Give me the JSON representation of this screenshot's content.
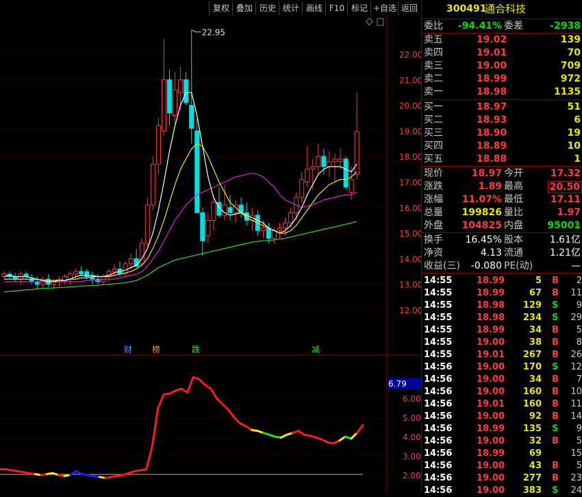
{
  "toolbar": {
    "buttons": [
      "复权",
      "叠加",
      "历史",
      "统计",
      "画线",
      "F10",
      "标记",
      "+自选",
      "返回"
    ]
  },
  "stock": {
    "code": "300491",
    "name": "通合科技"
  },
  "order_ratio": {
    "label1": "委比",
    "value1": "-94.41%",
    "label2": "委差",
    "value2": "-2938"
  },
  "sell_levels": [
    {
      "label": "卖五",
      "price": "19.02",
      "vol": "139"
    },
    {
      "label": "卖四",
      "price": "19.01",
      "vol": "70"
    },
    {
      "label": "卖三",
      "price": "19.00",
      "vol": "709"
    },
    {
      "label": "卖二",
      "price": "18.99",
      "vol": "972"
    },
    {
      "label": "卖一",
      "price": "18.98",
      "vol": "1135"
    }
  ],
  "buy_levels": [
    {
      "label": "买一",
      "price": "18.97",
      "vol": "51"
    },
    {
      "label": "买二",
      "price": "18.93",
      "vol": "6"
    },
    {
      "label": "买三",
      "price": "18.90",
      "vol": "19"
    },
    {
      "label": "买四",
      "price": "18.89",
      "vol": "10"
    },
    {
      "label": "买五",
      "price": "18.88",
      "vol": "1"
    }
  ],
  "quote": [
    {
      "l1": "现价",
      "v1": "18.97",
      "l2": "今开",
      "v2": "17.32"
    },
    {
      "l1": "涨跌",
      "v1": "1.89",
      "l2": "最高",
      "v2": "20.50"
    },
    {
      "l1": "涨幅",
      "v1": "11.07%",
      "l2": "最低",
      "v2": "17.11"
    },
    {
      "l1": "总量",
      "v1": "199826",
      "l2": "量比",
      "v2": "1.97"
    },
    {
      "l1": "外盘",
      "v1": "104825",
      "l2": "内盘",
      "v2": "95001"
    }
  ],
  "fundamentals": [
    {
      "l1": "换手",
      "v1": "16.45%",
      "l2": "股本",
      "v2": "1.61亿"
    },
    {
      "l1": "净资",
      "v1": "4.13",
      "l2": "流通",
      "v2": "1.21亿"
    },
    {
      "l1": "收益(三)",
      "v1": "-0.080",
      "l2": "PE(动)",
      "v2": "—"
    }
  ],
  "ticks": [
    {
      "time": "14:55",
      "price": "18.99",
      "vol": "5",
      "side": "B",
      "n": "2"
    },
    {
      "time": "14:55",
      "price": "18.99",
      "vol": "67",
      "side": "B",
      "n": "11"
    },
    {
      "time": "14:55",
      "price": "18.98",
      "vol": "129",
      "side": "S",
      "n": "9"
    },
    {
      "time": "14:55",
      "price": "18.98",
      "vol": "234",
      "side": "S",
      "n": "29"
    },
    {
      "time": "14:55",
      "price": "18.99",
      "vol": "34",
      "side": "B",
      "n": "5"
    },
    {
      "time": "14:55",
      "price": "19.00",
      "vol": "38",
      "side": "B",
      "n": "8"
    },
    {
      "time": "14:55",
      "price": "19.01",
      "vol": "267",
      "side": "B",
      "n": "26"
    },
    {
      "time": "14:56",
      "price": "19.00",
      "vol": "170",
      "side": "S",
      "n": "12"
    },
    {
      "time": "14:56",
      "price": "19.00",
      "vol": "34",
      "side": "B",
      "n": "7"
    },
    {
      "time": "14:56",
      "price": "19.00",
      "vol": "160",
      "side": "B",
      "n": "10"
    },
    {
      "time": "14:56",
      "price": "19.01",
      "vol": "160",
      "side": "B",
      "n": "11"
    },
    {
      "time": "14:56",
      "price": "19.00",
      "vol": "92",
      "side": "B",
      "n": "14"
    },
    {
      "time": "14:56",
      "price": "18.99",
      "vol": "135",
      "side": "S",
      "n": "9"
    },
    {
      "time": "14:56",
      "price": "19.00",
      "vol": "32",
      "side": "B",
      "n": "5"
    },
    {
      "time": "14:56",
      "price": "18.99",
      "vol": "69",
      "side": "",
      "n": "15"
    },
    {
      "time": "14:56",
      "price": "19.00",
      "vol": "43",
      "side": "B",
      "n": "5"
    },
    {
      "time": "14:56",
      "price": "19.00",
      "vol": "277",
      "side": "B",
      "n": "23"
    },
    {
      "time": "14:56",
      "price": "19.00",
      "vol": "383",
      "side": "S",
      "n": "24"
    }
  ],
  "chart": {
    "price_axis": [
      "22.00",
      "21.00",
      "20.00",
      "19.00",
      "18.00",
      "17.00",
      "16.00",
      "15.00",
      "14.00",
      "13.00",
      "12.00"
    ],
    "peak_label": "22.95",
    "event_markers": [
      "财",
      "榜",
      "跌",
      "减"
    ],
    "indicator_axis": [
      "6.00",
      "5.00",
      "4.00",
      "3.00",
      "2.00"
    ],
    "indicator_current": "6.79"
  },
  "chart_data": {
    "type": "line",
    "title": "",
    "xlabel": "",
    "ylabel": "",
    "ylim": [
      11.5,
      23.0
    ],
    "candles_ohlc": [
      [
        13.3,
        13.5,
        13.2,
        13.4
      ],
      [
        13.4,
        13.5,
        13.2,
        13.3
      ],
      [
        13.3,
        13.45,
        13.1,
        13.2
      ],
      [
        13.2,
        13.5,
        13.0,
        13.4
      ],
      [
        13.4,
        13.5,
        13.2,
        13.3
      ],
      [
        13.2,
        13.4,
        13.0,
        13.1
      ],
      [
        13.1,
        13.3,
        12.8,
        13.0
      ],
      [
        13.0,
        13.3,
        12.8,
        13.2
      ],
      [
        13.2,
        13.4,
        12.9,
        13.0
      ],
      [
        13.0,
        13.2,
        12.8,
        13.1
      ],
      [
        13.1,
        13.3,
        12.9,
        13.2
      ],
      [
        13.1,
        13.4,
        13.0,
        13.3
      ],
      [
        13.2,
        13.5,
        13.0,
        13.4
      ],
      [
        13.4,
        13.6,
        13.2,
        13.5
      ],
      [
        13.5,
        13.7,
        13.3,
        13.4
      ],
      [
        13.5,
        13.6,
        13.2,
        13.3
      ],
      [
        13.3,
        13.5,
        13.0,
        13.2
      ],
      [
        13.2,
        13.4,
        13.0,
        13.1
      ],
      [
        13.1,
        13.4,
        13.0,
        13.3
      ],
      [
        13.3,
        13.6,
        13.1,
        13.5
      ],
      [
        13.5,
        13.8,
        13.3,
        13.6
      ],
      [
        13.6,
        13.9,
        13.3,
        13.4
      ],
      [
        13.4,
        13.9,
        13.3,
        13.8
      ],
      [
        13.8,
        14.2,
        13.6,
        14.0
      ],
      [
        14.0,
        14.4,
        13.8,
        13.7
      ],
      [
        13.8,
        14.8,
        13.7,
        14.6
      ],
      [
        14.6,
        16.4,
        14.5,
        16.1
      ],
      [
        16.1,
        18.0,
        15.9,
        17.7
      ],
      [
        17.7,
        19.5,
        17.3,
        19.2
      ],
      [
        19.0,
        22.6,
        18.8,
        21.0
      ],
      [
        21.0,
        21.4,
        19.2,
        19.7
      ],
      [
        19.6,
        21.3,
        19.3,
        20.6
      ],
      [
        20.5,
        21.5,
        19.8,
        21.0
      ],
      [
        21.0,
        21.3,
        20.0,
        20.1
      ],
      [
        20.0,
        22.95,
        18.5,
        19.1
      ],
      [
        19.0,
        19.5,
        15.8,
        15.8
      ],
      [
        15.8,
        16.0,
        14.1,
        14.7
      ],
      [
        14.9,
        15.8,
        14.6,
        15.5
      ],
      [
        15.5,
        16.5,
        15.1,
        16.2
      ],
      [
        16.2,
        16.8,
        15.6,
        15.7
      ],
      [
        15.7,
        16.9,
        15.5,
        16.1
      ],
      [
        16.0,
        16.5,
        15.5,
        15.8
      ],
      [
        15.8,
        16.3,
        15.4,
        16.1
      ],
      [
        16.1,
        16.4,
        15.6,
        15.8
      ],
      [
        15.8,
        16.2,
        15.3,
        15.5
      ],
      [
        15.5,
        16.0,
        15.1,
        15.7
      ],
      [
        15.7,
        15.9,
        14.9,
        15.1
      ],
      [
        15.1,
        15.5,
        14.8,
        15.2
      ],
      [
        15.2,
        15.4,
        14.6,
        14.8
      ],
      [
        14.8,
        15.2,
        14.6,
        15.1
      ],
      [
        15.1,
        15.4,
        14.8,
        15.2
      ],
      [
        15.2,
        15.6,
        14.9,
        15.4
      ],
      [
        15.4,
        16.0,
        15.2,
        15.8
      ],
      [
        15.8,
        16.6,
        15.5,
        16.4
      ],
      [
        16.4,
        17.4,
        16.2,
        17.1
      ],
      [
        17.0,
        18.4,
        16.8,
        17.5
      ],
      [
        17.5,
        17.9,
        16.7,
        17.6
      ],
      [
        17.6,
        18.5,
        17.3,
        18.0
      ],
      [
        18.0,
        18.3,
        17.3,
        17.6
      ],
      [
        17.6,
        18.2,
        17.2,
        17.8
      ],
      [
        17.8,
        18.1,
        17.0,
        17.9
      ],
      [
        17.8,
        18.3,
        17.5,
        17.9
      ],
      [
        17.9,
        18.0,
        16.7,
        16.8
      ],
      [
        16.6,
        17.6,
        16.3,
        17.1
      ],
      [
        17.3,
        20.5,
        17.1,
        18.97
      ]
    ],
    "ma_white": [
      13.3,
      13.35,
      13.3,
      13.3,
      13.3,
      13.25,
      13.2,
      13.15,
      13.1,
      13.1,
      13.15,
      13.15,
      13.2,
      13.3,
      13.35,
      13.35,
      13.35,
      13.3,
      13.3,
      13.35,
      13.45,
      13.5,
      13.55,
      13.65,
      13.75,
      14.0,
      14.4,
      15.0,
      15.9,
      17.0,
      18.2,
      19.2,
      20.0,
      20.5,
      20.5,
      19.6,
      18.4,
      17.2,
      16.4,
      16.0,
      15.8,
      15.7,
      15.75,
      15.8,
      15.7,
      15.6,
      15.5,
      15.4,
      15.2,
      15.1,
      15.0,
      15.1,
      15.3,
      15.6,
      16.0,
      16.5,
      16.9,
      17.3,
      17.5,
      17.6,
      17.6,
      17.6,
      17.5,
      17.4,
      17.7
    ],
    "ma_yellow": [
      13.2,
      13.2,
      13.2,
      13.2,
      13.2,
      13.2,
      13.2,
      13.15,
      13.15,
      13.15,
      13.15,
      13.15,
      13.2,
      13.2,
      13.25,
      13.25,
      13.3,
      13.3,
      13.3,
      13.3,
      13.35,
      13.4,
      13.45,
      13.5,
      13.6,
      13.75,
      14.0,
      14.4,
      14.9,
      15.5,
      16.2,
      16.9,
      17.5,
      17.9,
      18.3,
      18.5,
      18.4,
      18.0,
      17.5,
      17.0,
      16.6,
      16.2,
      16.0,
      15.8,
      15.6,
      15.5,
      15.4,
      15.3,
      15.2,
      15.1,
      15.0,
      15.0,
      15.1,
      15.3,
      15.6,
      15.9,
      16.2,
      16.5,
      16.7,
      16.9,
      17.0,
      17.1,
      17.1,
      17.2,
      17.4
    ],
    "ma_magenta": [
      13.1,
      13.1,
      13.1,
      13.1,
      13.1,
      13.1,
      13.1,
      13.1,
      13.1,
      13.1,
      13.1,
      13.1,
      13.1,
      13.1,
      13.1,
      13.15,
      13.15,
      13.15,
      13.2,
      13.2,
      13.2,
      13.25,
      13.3,
      13.35,
      13.4,
      13.5,
      13.7,
      14.0,
      14.3,
      14.7,
      15.1,
      15.5,
      15.8,
      16.1,
      16.3,
      16.5,
      16.6,
      16.7,
      16.8,
      16.9,
      17.0,
      17.1,
      17.2,
      17.25,
      17.3,
      17.35,
      17.3,
      17.2,
      17.0,
      16.8,
      16.5,
      16.3,
      16.2,
      16.1,
      16.0,
      16.05,
      16.1,
      16.2,
      16.3,
      16.35,
      16.4,
      16.45,
      16.5,
      16.5,
      16.6
    ],
    "ma_green": [
      12.7,
      12.72,
      12.74,
      12.76,
      12.78,
      12.8,
      12.82,
      12.84,
      12.85,
      12.86,
      12.87,
      12.88,
      12.9,
      12.91,
      12.93,
      12.94,
      12.95,
      12.96,
      12.98,
      13.0,
      13.02,
      13.04,
      13.06,
      13.1,
      13.15,
      13.25,
      13.35,
      13.5,
      13.65,
      13.75,
      13.85,
      13.95,
      14.0,
      14.05,
      14.1,
      14.15,
      14.2,
      14.25,
      14.3,
      14.35,
      14.4,
      14.45,
      14.5,
      14.55,
      14.6,
      14.65,
      14.68,
      14.7,
      14.72,
      14.74,
      14.77,
      14.8,
      14.85,
      14.9,
      14.95,
      15.0,
      15.05,
      15.1,
      15.15,
      15.2,
      15.25,
      15.3,
      15.35,
      15.4,
      15.45
    ],
    "indicator": [
      2.3,
      2.3,
      2.25,
      2.2,
      2.15,
      2.1,
      2.05,
      2.0,
      2.05,
      2.1,
      2.0,
      1.95,
      2.0,
      2.2,
      2.05,
      2.0,
      1.95,
      1.9,
      1.85,
      1.9,
      1.95,
      2.0,
      2.1,
      2.2,
      2.25,
      2.3,
      3.5,
      5.5,
      6.2,
      6.25,
      6.4,
      6.5,
      6.3,
      7.1,
      7.0,
      6.7,
      6.5,
      6.0,
      5.7,
      5.4,
      5.0,
      4.7,
      4.55,
      4.35,
      4.3,
      4.2,
      4.1,
      4.0,
      3.95,
      4.1,
      4.2,
      4.3,
      4.1,
      4.05,
      3.95,
      3.85,
      3.7,
      3.65,
      3.8,
      4.0,
      3.9,
      4.2,
      4.6
    ],
    "indicator_colors": [
      "red",
      "red",
      "red",
      "red",
      "red",
      "red",
      "yellow",
      "red",
      "yellow",
      "yellow",
      "red",
      "yellow",
      "blue",
      "blue",
      "blue",
      "blue",
      "blue",
      "yellow",
      "red",
      "red",
      "red",
      "red",
      "red",
      "red",
      "red",
      "red",
      "red",
      "red",
      "red",
      "red",
      "red",
      "red",
      "red",
      "red",
      "red",
      "red",
      "red",
      "red",
      "red",
      "red",
      "red",
      "red",
      "red",
      "yellow",
      "yellow",
      "green",
      "green",
      "green",
      "yellow",
      "yellow",
      "red",
      "red",
      "red",
      "red",
      "red",
      "red",
      "red",
      "red",
      "yellow",
      "green",
      "yellow",
      "red"
    ]
  }
}
